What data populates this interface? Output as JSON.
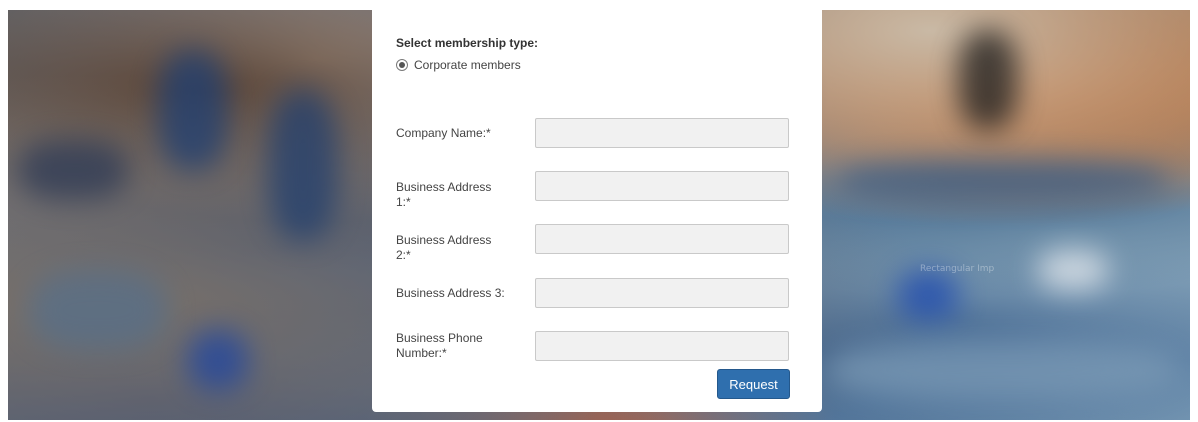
{
  "form": {
    "membership_heading": "Select membership type:",
    "membership_option": "Corporate members",
    "fields": [
      {
        "label": "Company Name:*",
        "value": ""
      },
      {
        "label": "Business Address 1:*",
        "value": ""
      },
      {
        "label": "Business Address 2:*",
        "value": ""
      },
      {
        "label": "Business Address 3:",
        "value": ""
      },
      {
        "label": "Business Phone Number:*",
        "value": ""
      }
    ],
    "submit_label": "Request"
  },
  "background": {
    "overlay_text": "Rectangular Imp"
  },
  "colors": {
    "button": "#2f6fae",
    "field_bg": "#f1f1f1",
    "card_bg": "#ffffff"
  }
}
